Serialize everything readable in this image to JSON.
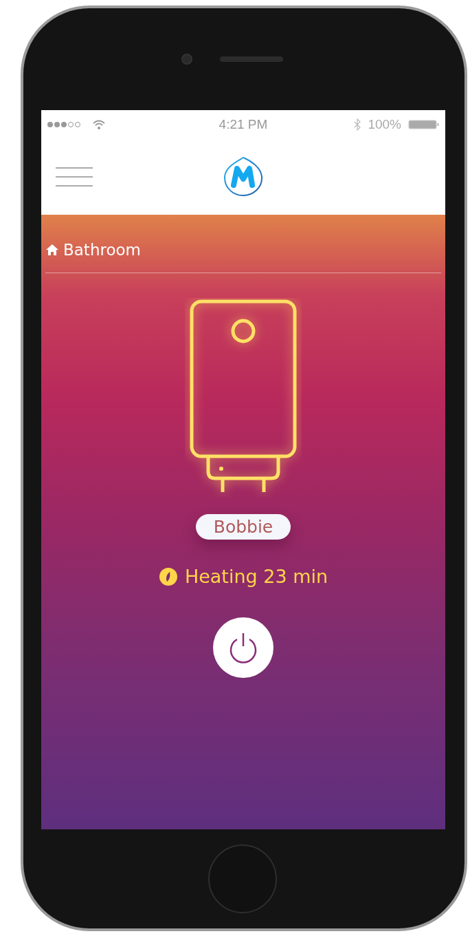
{
  "status_bar": {
    "time": "4:21 PM",
    "battery": "100%"
  },
  "location": {
    "label": "Bathroom"
  },
  "device": {
    "name": "Bobbie",
    "status": "Heating 23 min"
  }
}
